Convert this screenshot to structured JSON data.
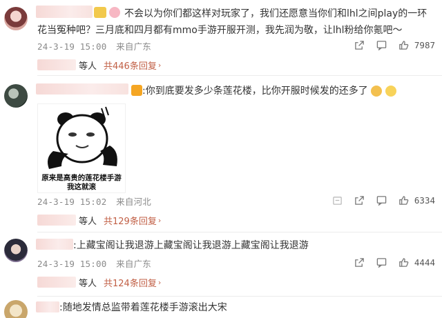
{
  "comments": [
    {
      "text": "不会以为你们都这样对玩家了，我们还愿意当你们和lhl之间play的一环花当冤种吧？三月底和四月都有mmo手游开服开测，我先润为敬，让lhl粉给你氪吧～",
      "date": "24-3-19 15:00",
      "location": "来自广东",
      "likes": "7987",
      "replies_suffix": "等人",
      "replies_link": "共446条回复"
    },
    {
      "text": ":你到底要发多少条莲花楼，比你开服时候发的还多了",
      "sticker_caption_1": "原来是高贵的莲花楼手游",
      "sticker_caption_2": "我这就滚",
      "date": "24-3-19 15:02",
      "location": "来自河北",
      "likes": "6334",
      "replies_suffix": "等人",
      "replies_link": "共129条回复"
    },
    {
      "text": ":上藏宝阁让我退游上藏宝阁让我退游上藏宝阁让我退游",
      "date": "24-3-19 15:00",
      "location": "来自广东",
      "likes": "4444",
      "replies_suffix": "等人",
      "replies_link": "共124条回复"
    },
    {
      "text": ":随地发情总监带着莲花楼手游滚出大宋"
    }
  ],
  "icons": {
    "share": "share-icon",
    "comment": "comment-icon",
    "like": "thumbs-up-icon",
    "repost": "repost-icon"
  },
  "colors": {
    "link": "#c15f45",
    "meta": "#8a8a8a"
  }
}
